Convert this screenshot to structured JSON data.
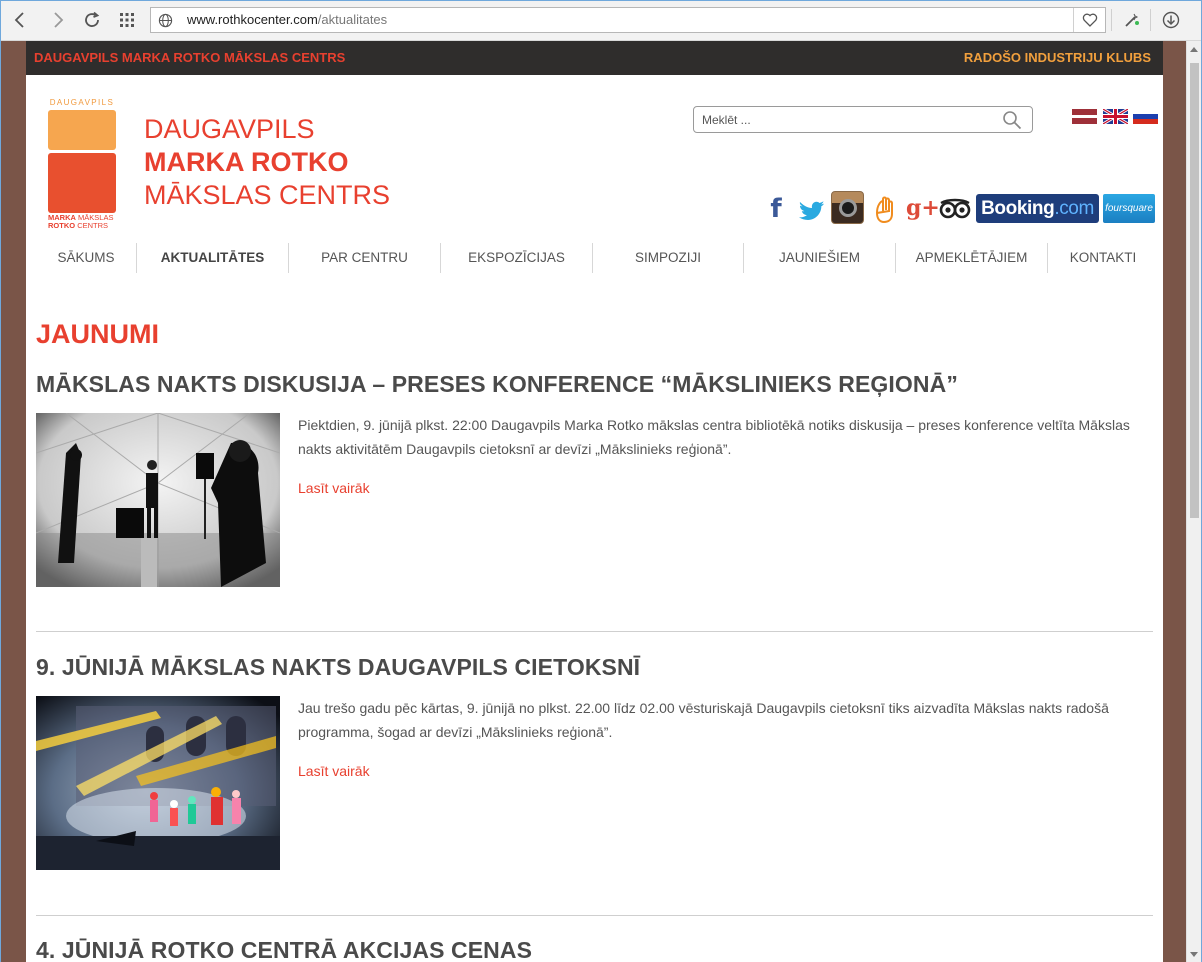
{
  "browser": {
    "url_domain": "www.rothkocenter.com",
    "url_path": "/aktualitates"
  },
  "topbar": {
    "left": "DAUGAVPILS MARKA ROTKO MĀKSLAS CENTRS",
    "right": "RADOŠO INDUSTRIJU KLUBS"
  },
  "logo": {
    "top_text": "DAUGAVPILS",
    "bottom_bold": "MARKA",
    "bottom_word1": "MĀKSLAS",
    "bottom_bold2": "ROTKO",
    "bottom_word2": "CENTRS"
  },
  "site_title": {
    "line1": "DAUGAVPILS",
    "line2": "MARKA ROTKO",
    "line3": "MĀKSLAS CENTRS"
  },
  "search": {
    "placeholder": "Meklēt ..."
  },
  "languages": [
    "lv",
    "en",
    "ru"
  ],
  "social": {
    "facebook": "f",
    "googleplus": "g+",
    "booking": "Booking",
    "booking_dotcom": ".com",
    "foursquare": "foursquare"
  },
  "nav": {
    "items": [
      "SĀKUMS",
      "AKTUALITĀTES",
      "PAR CENTRU",
      "EKSPOZĪCIJAS",
      "SIMPOZIJI",
      "JAUNIEŠIEM",
      "APMEKLĒTĀJIEM",
      "KONTAKTI"
    ],
    "active": "AKTUALITĀTES"
  },
  "section_title": "JAUNUMI",
  "posts": [
    {
      "title": "MĀKSLAS NAKTS DISKUSIJA – PRESES KONFERENCE “MĀKSLINIEKS REĢIONĀ”",
      "text": "Piektdien, 9. jūnijā plkst. 22:00 Daugavpils Marka Rotko mākslas centra bibliotēkā notiks diskusija – preses konference veltīta Mākslas nakts aktivitātēm Daugavpils cietoksnī ar devīzi „Mākslinieks reģionā”.",
      "read_more": "Lasīt vairāk"
    },
    {
      "title": "9. JŪNIJĀ MĀKSLAS NAKTS DAUGAVPILS CIETOKSNĪ",
      "text": "Jau trešo gadu pēc kārtas, 9. jūnijā no plkst. 22.00 līdz 02.00 vēsturiskajā Daugavpils cietoksnī tiks aizvadīta Mākslas nakts radošā programma, šogad ar devīzi „Mākslinieks reģionā”.",
      "read_more": "Lasīt vairāk"
    },
    {
      "title": "4. JŪNIJĀ ROTKO CENTRĀ AKCIJAS CENAS"
    }
  ],
  "colors": {
    "accent": "#e8402f",
    "orange": "#f2a03d",
    "frame": "#7a5548",
    "topbar": "#2f2d2c"
  }
}
